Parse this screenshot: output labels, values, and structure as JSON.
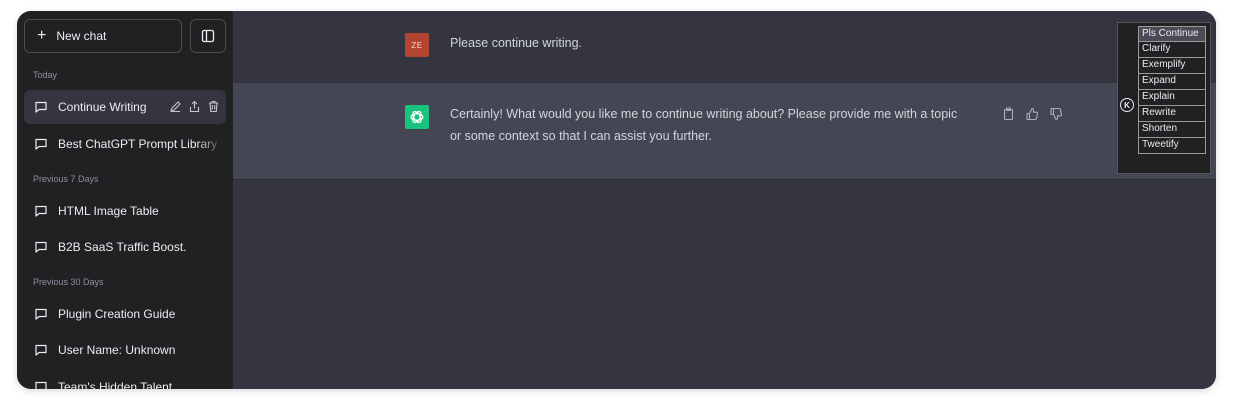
{
  "sidebar": {
    "new_chat_label": "New chat",
    "sections": {
      "today": "Today",
      "prev7": "Previous 7 Days",
      "prev30": "Previous 30 Days"
    },
    "items": [
      {
        "label": "Continue Writing"
      },
      {
        "label": "Best ChatGPT Prompt Library"
      },
      {
        "label": "HTML Image Table"
      },
      {
        "label": "B2B SaaS Traffic Boost."
      },
      {
        "label": "Plugin Creation Guide"
      },
      {
        "label": "User Name: Unknown"
      },
      {
        "label": "Team's Hidden Talent"
      }
    ]
  },
  "conversation": {
    "user": {
      "avatar_initials": "ZE",
      "text": "Please continue writing."
    },
    "assistant": {
      "line1": "Certainly! What would you like me to continue writing about? Please provide me with a topic",
      "line2": "or some context so that I can assist you further."
    }
  },
  "plugin_panel": {
    "logo_letter": "K",
    "buttons": [
      "Pls Continue",
      "Clarify",
      "Exemplify",
      "Expand",
      "Explain",
      "Rewrite",
      "Shorten",
      "Tweetify"
    ]
  },
  "colors": {
    "sidebar_bg": "#202123",
    "main_bg": "#343541",
    "assistant_bg": "#444654",
    "user_avatar": "#b4442f",
    "assistant_avatar": "#19c37d"
  }
}
